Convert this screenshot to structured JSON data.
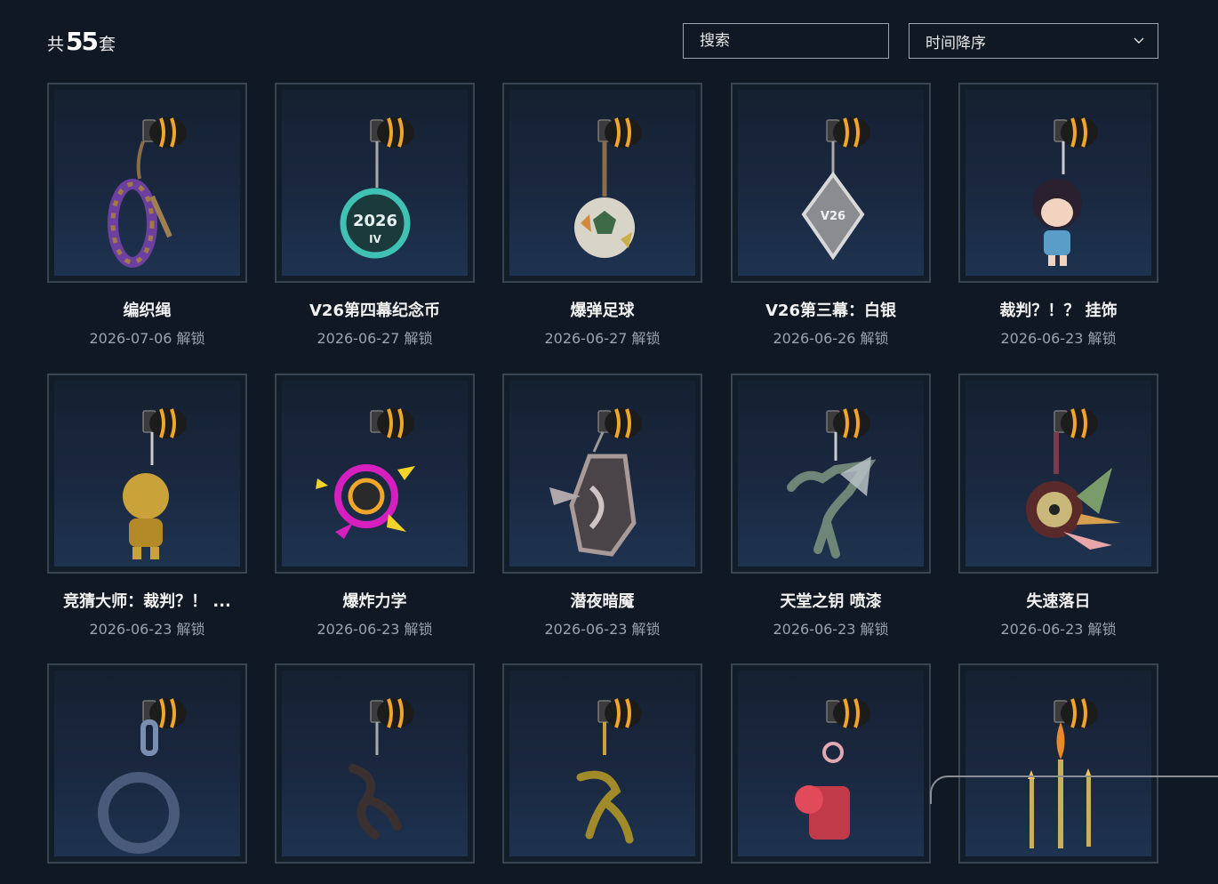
{
  "header": {
    "count_prefix": "共",
    "count_value": "55",
    "count_suffix": "套",
    "search_placeholder": "搜索",
    "sort_value": "时间降序"
  },
  "items": [
    {
      "name": "编织绳",
      "date": "2026-07-06 解锁",
      "icon": "braided-rope-charm-icon"
    },
    {
      "name": "V26第四幕纪念币",
      "date": "2026-06-27 解锁",
      "icon": "coin-charm-icon"
    },
    {
      "name": "爆弹足球",
      "date": "2026-06-27 解锁",
      "icon": "soccer-ball-charm-icon"
    },
    {
      "name": "V26第三幕：白银",
      "date": "2026-06-26 解锁",
      "icon": "silver-badge-charm-icon"
    },
    {
      "name": "裁判？！？ 挂饰",
      "date": "2026-06-23 解锁",
      "icon": "character-figure-charm-icon"
    },
    {
      "name": "竞猜大师：裁判？！ ...",
      "date": "2026-06-23 解锁",
      "icon": "gold-figure-charm-icon"
    },
    {
      "name": "爆炸力学",
      "date": "2026-06-23 解锁",
      "icon": "explosion-charm-icon"
    },
    {
      "name": "潜夜暗魇",
      "date": "2026-06-23 解锁",
      "icon": "dark-shield-charm-icon"
    },
    {
      "name": "天堂之钥 喷漆",
      "date": "2026-06-23 解锁",
      "icon": "pegasus-charm-icon"
    },
    {
      "name": "失速落日",
      "date": "2026-06-23 解锁",
      "icon": "disc-wing-charm-icon"
    },
    {
      "name": "",
      "date": "",
      "icon": "ring-charm-icon"
    },
    {
      "name": "",
      "date": "",
      "icon": "branch-charm-icon"
    },
    {
      "name": "",
      "date": "",
      "icon": "gold-branch-charm-icon"
    },
    {
      "name": "",
      "date": "",
      "icon": "pink-flower-charm-icon"
    },
    {
      "name": "",
      "date": "",
      "icon": "candle-charm-icon"
    }
  ]
}
